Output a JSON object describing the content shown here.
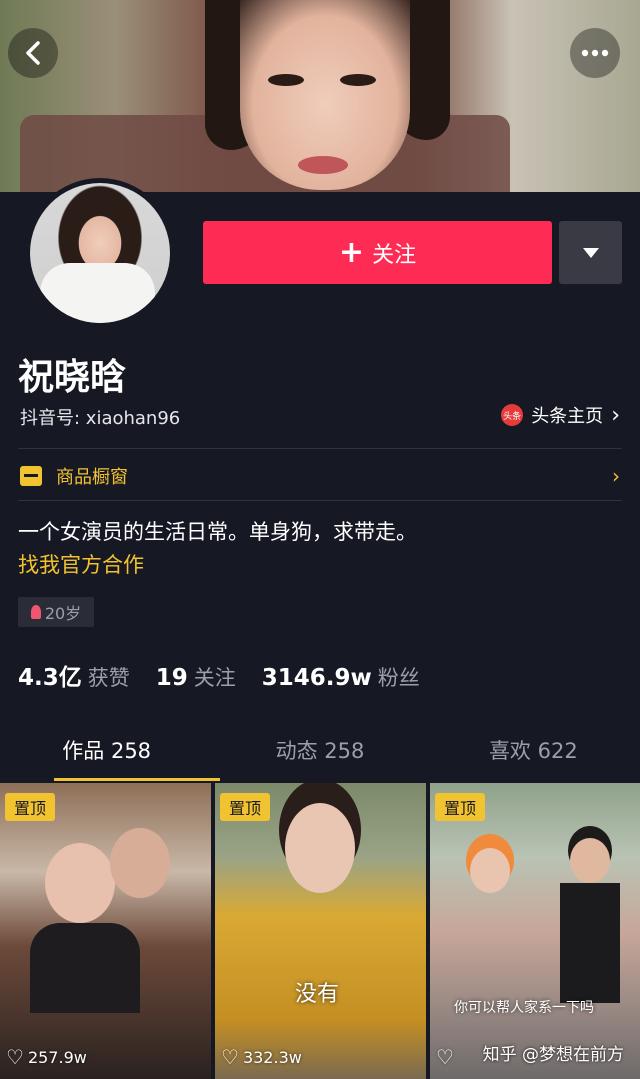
{
  "profile": {
    "name": "祝晓晗",
    "douyin_id": "抖音号: xiaohan96",
    "toutiao_icon": "头条",
    "toutiao_link": "头条主页",
    "shop_label": "商品橱窗",
    "bio": "一个女演员的生活日常。单身狗，求带走。",
    "coop_link": "找我官方合作",
    "age": "20岁"
  },
  "actions": {
    "follow_label": "关注",
    "follow_icon": "+",
    "back_icon": "back-arrow-icon",
    "more_icon": "more-dots-icon"
  },
  "stats": [
    {
      "value": "4.3亿",
      "label": "获赞"
    },
    {
      "value": "19",
      "label": "关注"
    },
    {
      "value": "3146.9w",
      "label": "粉丝"
    }
  ],
  "tabs": [
    {
      "label": "作品 258"
    },
    {
      "label": "动态 258"
    },
    {
      "label": "喜欢 622"
    }
  ],
  "videos": [
    {
      "pin": "置顶",
      "likes": "257.9w",
      "caption": ""
    },
    {
      "pin": "置顶",
      "likes": "332.3w",
      "caption": "没有"
    },
    {
      "pin": "置顶",
      "likes": "",
      "caption": "你可以帮人家系一下吗"
    }
  ],
  "watermark": "知乎 @梦想在前方",
  "colors": {
    "background": "#161823",
    "follow": "#fe2c55",
    "accent_yellow": "#f2c330",
    "muted_text": "#9d9fa8"
  }
}
